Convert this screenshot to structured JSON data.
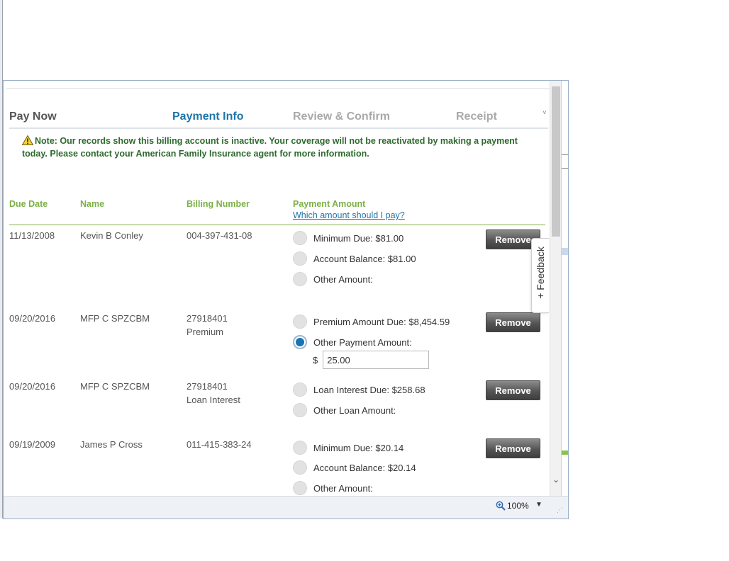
{
  "steps": {
    "pay_now": "Pay Now",
    "payment_info": "Payment Info",
    "review_confirm": "Review & Confirm",
    "receipt": "Receipt"
  },
  "note": "Note: Our records show this billing account is inactive. Your coverage will not be reactivated by making a payment today. Please contact your American Family Insurance agent for more information.",
  "headers": {
    "due_date": "Due Date",
    "name": "Name",
    "billing_number": "Billing Number",
    "payment_amount": "Payment Amount",
    "help_link": "Which amount should I pay?"
  },
  "rows": [
    {
      "due_date": "11/13/2008",
      "name": "Kevin B Conley",
      "billing_number": "004-397-431-08",
      "options": [
        "Minimum Due: $81.00",
        "Account Balance: $81.00",
        "Other Amount:"
      ],
      "remove": "Remove"
    },
    {
      "due_date": "09/20/2016",
      "name": "MFP C SPZCBM",
      "billing_number": "27918401",
      "billing_type": "Premium",
      "options": [
        "Premium Amount Due: $8,454.59",
        "Other Payment Amount:"
      ],
      "currency_symbol": "$",
      "amount_value": "25.00",
      "remove": "Remove"
    },
    {
      "due_date": "09/20/2016",
      "name": "MFP C SPZCBM",
      "billing_number": "27918401",
      "billing_type": "Loan Interest",
      "options": [
        "Loan Interest Due: $258.68",
        "Other Loan Amount:"
      ],
      "remove": "Remove"
    },
    {
      "due_date": "09/19/2009",
      "name": "James P Cross",
      "billing_number": "011-415-383-24",
      "options": [
        "Minimum Due: $20.14",
        "Account Balance: $20.14",
        "Other Amount:"
      ],
      "remove": "Remove"
    }
  ],
  "feedback": "+ Feedback",
  "status": {
    "zoom": "100%"
  },
  "colors": {
    "accent_green": "#7bb046",
    "link_blue": "#1f75a8",
    "note_green": "#2e6a2e"
  }
}
